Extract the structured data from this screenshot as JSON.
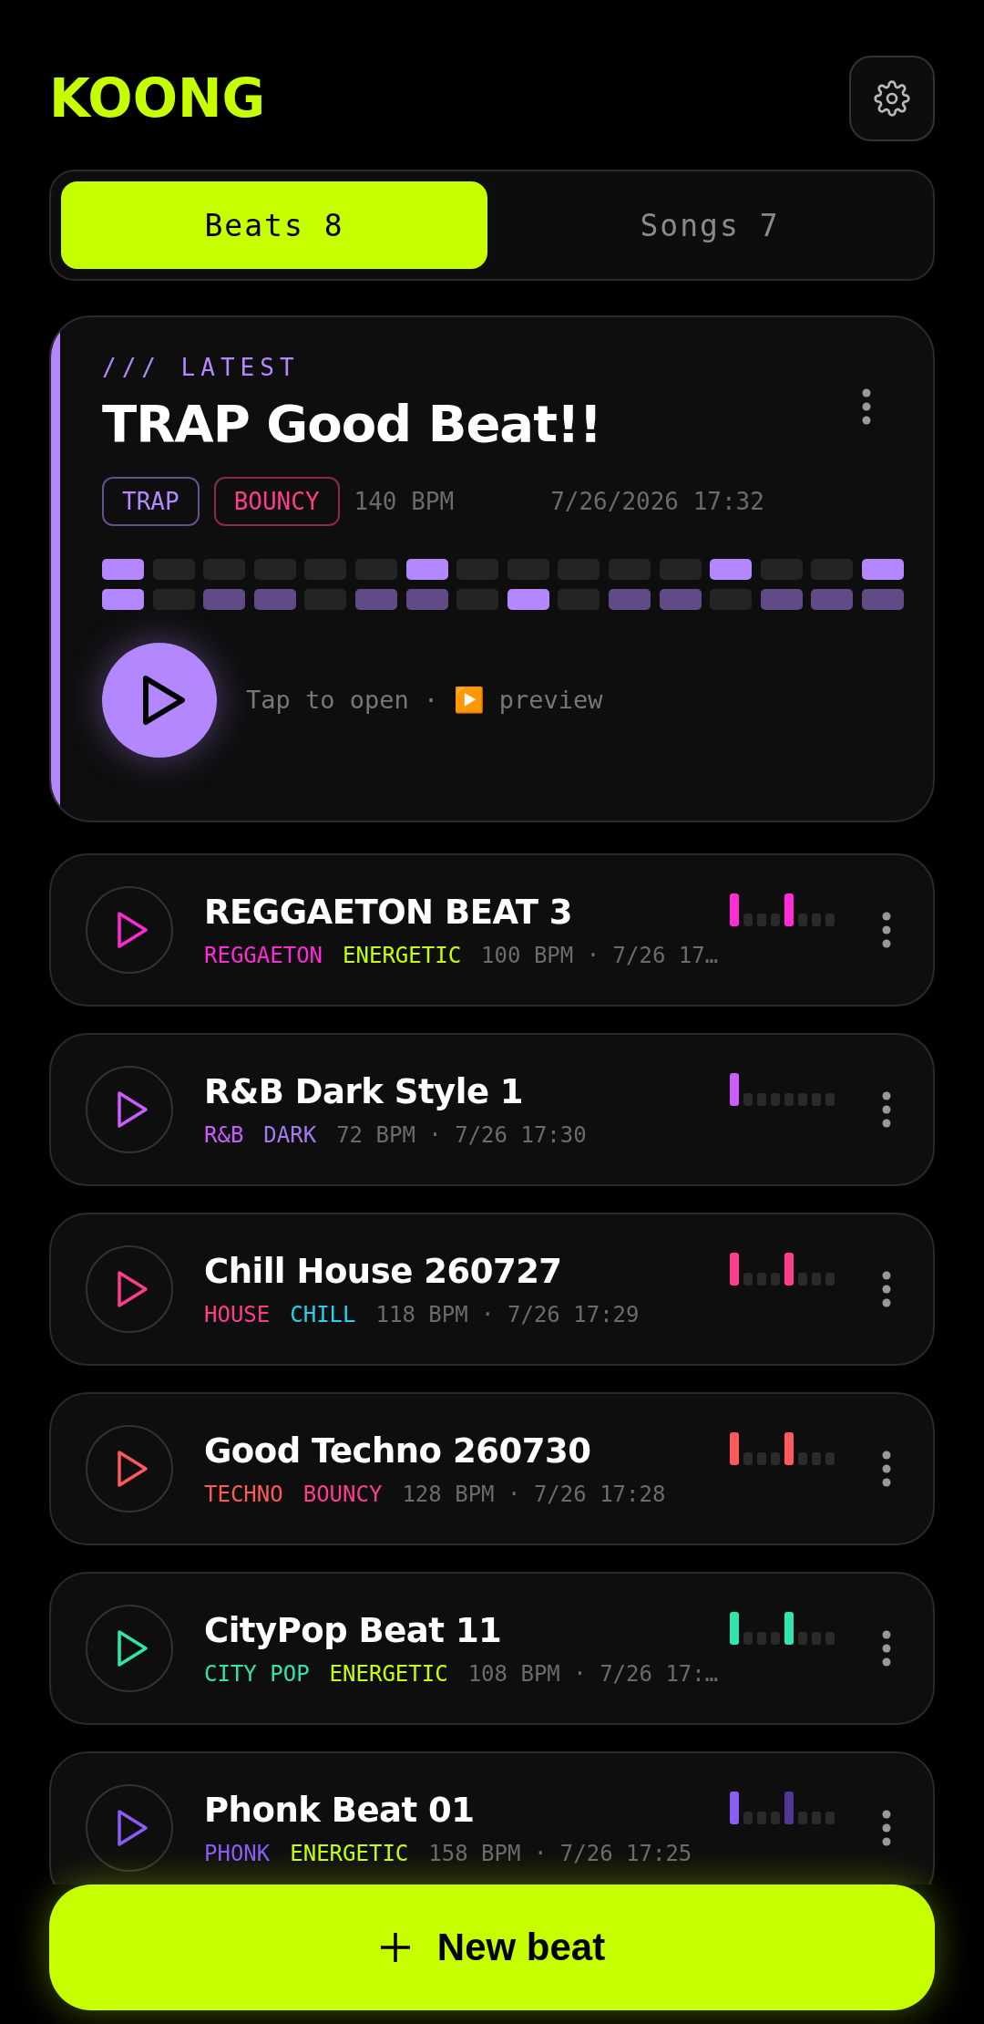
{
  "app": {
    "title": "KOONG"
  },
  "tabs": [
    {
      "label": "Beats 8",
      "selected": true
    },
    {
      "label": "Songs 7",
      "selected": false
    }
  ],
  "latest": {
    "eyebrow": "/// LATEST",
    "title": "TRAP Good Beat!!",
    "color": "#b388ff",
    "tags": [
      {
        "label": "TRAP",
        "color": "#b388ff"
      },
      {
        "label": "BOUNCY",
        "color": "#ff3d8b"
      }
    ],
    "bpm": "140 BPM",
    "date": "7/26/2026 17:32",
    "pattern": [
      [
        {
          "on": true,
          "strong": true
        },
        {
          "on": false
        },
        {
          "on": false
        },
        {
          "on": false
        },
        {
          "on": false
        },
        {
          "on": false
        },
        {
          "on": true,
          "strong": true
        },
        {
          "on": false
        },
        {
          "on": false
        },
        {
          "on": false
        },
        {
          "on": false
        },
        {
          "on": false
        },
        {
          "on": true,
          "strong": true
        },
        {
          "on": false
        },
        {
          "on": false
        },
        {
          "on": true,
          "strong": true
        }
      ],
      [
        {
          "on": true,
          "strong": true
        },
        {
          "on": false
        },
        {
          "on": true,
          "strong": false
        },
        {
          "on": true,
          "strong": false
        },
        {
          "on": false
        },
        {
          "on": true,
          "strong": false
        },
        {
          "on": true,
          "strong": false
        },
        {
          "on": false
        },
        {
          "on": true,
          "strong": true
        },
        {
          "on": false
        },
        {
          "on": true,
          "strong": false
        },
        {
          "on": true,
          "strong": false
        },
        {
          "on": false
        },
        {
          "on": true,
          "strong": false
        },
        {
          "on": true,
          "strong": false
        },
        {
          "on": true,
          "strong": false
        }
      ]
    ],
    "hint": "Tap to open · ▶️ preview"
  },
  "beats": [
    {
      "title": "REGGAETON BEAT 3",
      "color": "#ff2bd6",
      "tags": [
        {
          "label": "REGGAETON",
          "color": "#ff2bd6"
        },
        {
          "label": "ENERGETIC",
          "color": "#c6ff00"
        }
      ],
      "meta": "100 BPM · 7/26 17…",
      "pattern": [
        {
          "on": true,
          "strong": true
        },
        {
          "on": false
        },
        {
          "on": false
        },
        {
          "on": false
        },
        {
          "on": true,
          "strong": true
        },
        {
          "on": false
        },
        {
          "on": false
        },
        {
          "on": false
        }
      ]
    },
    {
      "title": "R&B Dark Style 1",
      "color": "#cc5cff",
      "tags": [
        {
          "label": "R&B",
          "color": "#cc5cff"
        },
        {
          "label": "DARK",
          "color": "#a37cf0"
        }
      ],
      "meta": "72 BPM · 7/26 17:30",
      "pattern": [
        {
          "on": true,
          "strong": true
        },
        {
          "on": false
        },
        {
          "on": false
        },
        {
          "on": false
        },
        {
          "on": false
        },
        {
          "on": false
        },
        {
          "on": false
        },
        {
          "on": false
        }
      ]
    },
    {
      "title": "Chill House 260727",
      "color": "#ff3d8b",
      "tags": [
        {
          "label": "HOUSE",
          "color": "#ff3d8b"
        },
        {
          "label": "CHILL",
          "color": "#22d3ee"
        }
      ],
      "meta": "118 BPM · 7/26 17:29",
      "pattern": [
        {
          "on": true,
          "strong": true
        },
        {
          "on": false
        },
        {
          "on": false
        },
        {
          "on": false
        },
        {
          "on": true,
          "strong": true
        },
        {
          "on": false
        },
        {
          "on": false
        },
        {
          "on": false
        }
      ]
    },
    {
      "title": "Good Techno 260730",
      "color": "#ff5a5a",
      "tags": [
        {
          "label": "TECHNO",
          "color": "#ff5a5a"
        },
        {
          "label": "BOUNCY",
          "color": "#ff3d8b"
        }
      ],
      "meta": "128 BPM · 7/26 17:28",
      "pattern": [
        {
          "on": true,
          "strong": true
        },
        {
          "on": false
        },
        {
          "on": false
        },
        {
          "on": false
        },
        {
          "on": true,
          "strong": true
        },
        {
          "on": false
        },
        {
          "on": false
        },
        {
          "on": false
        }
      ]
    },
    {
      "title": "CityPop Beat 11",
      "color": "#2ee6b0",
      "tags": [
        {
          "label": "CITY POP",
          "color": "#2ee6b0"
        },
        {
          "label": "ENERGETIC",
          "color": "#c6ff00"
        }
      ],
      "meta": "108 BPM · 7/26 17:…",
      "pattern": [
        {
          "on": true,
          "strong": true
        },
        {
          "on": false
        },
        {
          "on": false
        },
        {
          "on": false
        },
        {
          "on": true,
          "strong": true
        },
        {
          "on": false
        },
        {
          "on": false
        },
        {
          "on": false
        }
      ]
    },
    {
      "title": "Phonk Beat 01",
      "color": "#8b5cf6",
      "tags": [
        {
          "label": "PHONK",
          "color": "#8b5cf6"
        },
        {
          "label": "ENERGETIC",
          "color": "#c6ff00"
        }
      ],
      "meta": "158 BPM · 7/26 17:25",
      "pattern": [
        {
          "on": true,
          "strong": true
        },
        {
          "on": false
        },
        {
          "on": false
        },
        {
          "on": false
        },
        {
          "on": true,
          "strong": false
        },
        {
          "on": false
        },
        {
          "on": false
        },
        {
          "on": false
        }
      ]
    }
  ],
  "new_button": {
    "label": "New beat"
  }
}
